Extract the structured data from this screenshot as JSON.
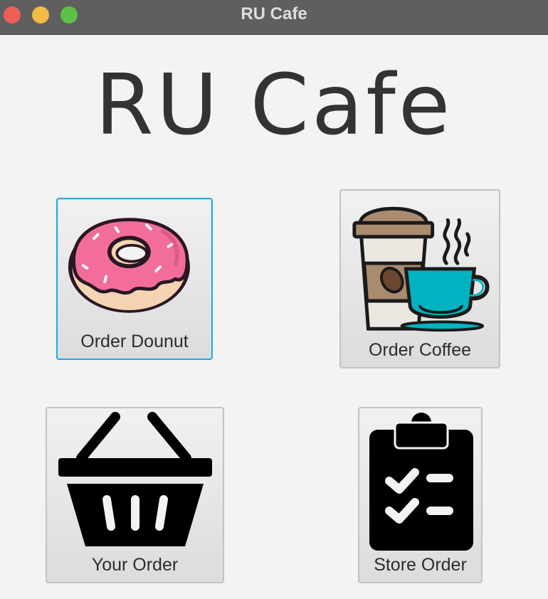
{
  "window": {
    "title": "RU Cafe"
  },
  "heading": "RU Cafe",
  "buttons": {
    "order_donut": {
      "label": "Order Dounut",
      "icon": "donut-icon"
    },
    "order_coffee": {
      "label": "Order Coffee",
      "icon": "coffee-icon"
    },
    "your_order": {
      "label": "Your Order",
      "icon": "basket-icon"
    },
    "store_order": {
      "label": "Store Order",
      "icon": "clipboard-icon"
    }
  },
  "colors": {
    "focus_ring": "#2ea4dc",
    "donut_frosting": "#f26d9a",
    "donut_dough": "#f5d3b3",
    "cup_teal": "#00b3c1",
    "coffee_lid": "#a98b6e"
  }
}
